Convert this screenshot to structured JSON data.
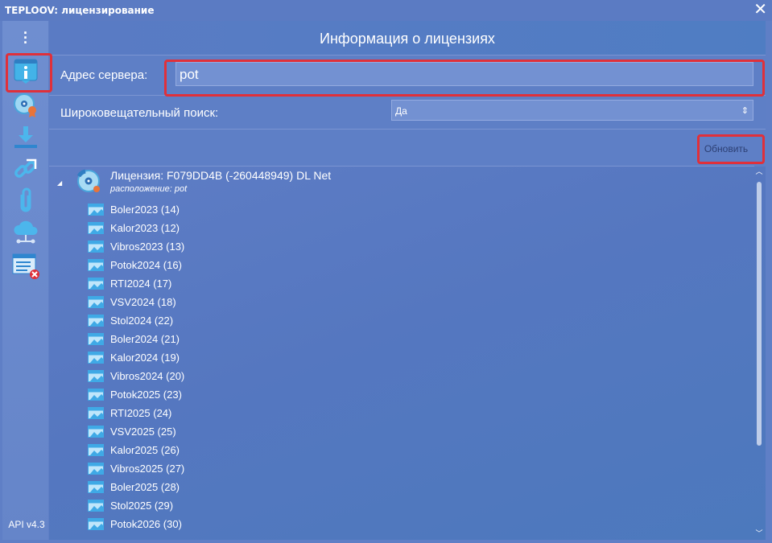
{
  "window": {
    "title": "TEPLOOV:  лицензирование",
    "close_glyph": "✕"
  },
  "sidebar": {
    "menu_icon": "kebab-menu-icon",
    "items": [
      {
        "icon": "info-icon",
        "active": true
      },
      {
        "icon": "license-disc-icon"
      },
      {
        "icon": "download-icon"
      },
      {
        "icon": "link-icon"
      },
      {
        "icon": "paperclip-icon"
      },
      {
        "icon": "cloud-network-icon"
      },
      {
        "icon": "list-delete-icon"
      }
    ],
    "api_version": "API v4.3"
  },
  "main": {
    "title": "Информация о лицензиях",
    "server": {
      "label": "Адрес сервера:",
      "value": "pot"
    },
    "broadcast": {
      "label": "Широковещательный поиск:",
      "value": "Да"
    },
    "refresh_label": "Обновить",
    "license": {
      "title": "Лицензия: F079DD4B (-260448949) DL Net",
      "location": "расположение: pot",
      "items": [
        "Boler2023 (14)",
        "Kalor2023 (12)",
        "Vibros2023 (13)",
        "Potok2024 (16)",
        "RTI2024 (17)",
        "VSV2024 (18)",
        "Stol2024 (22)",
        "Boler2024 (21)",
        "Kalor2024 (19)",
        "Vibros2024 (20)",
        "Potok2025 (23)",
        "RTI2025 (24)",
        "VSV2025 (25)",
        "Kalor2025 (26)",
        "Vibros2025 (27)",
        "Boler2025 (28)",
        "Stol2025 (29)",
        "Potok2026 (30)"
      ]
    }
  },
  "colors": {
    "highlight": "#e0303a",
    "accent": "#5f7fc6"
  }
}
